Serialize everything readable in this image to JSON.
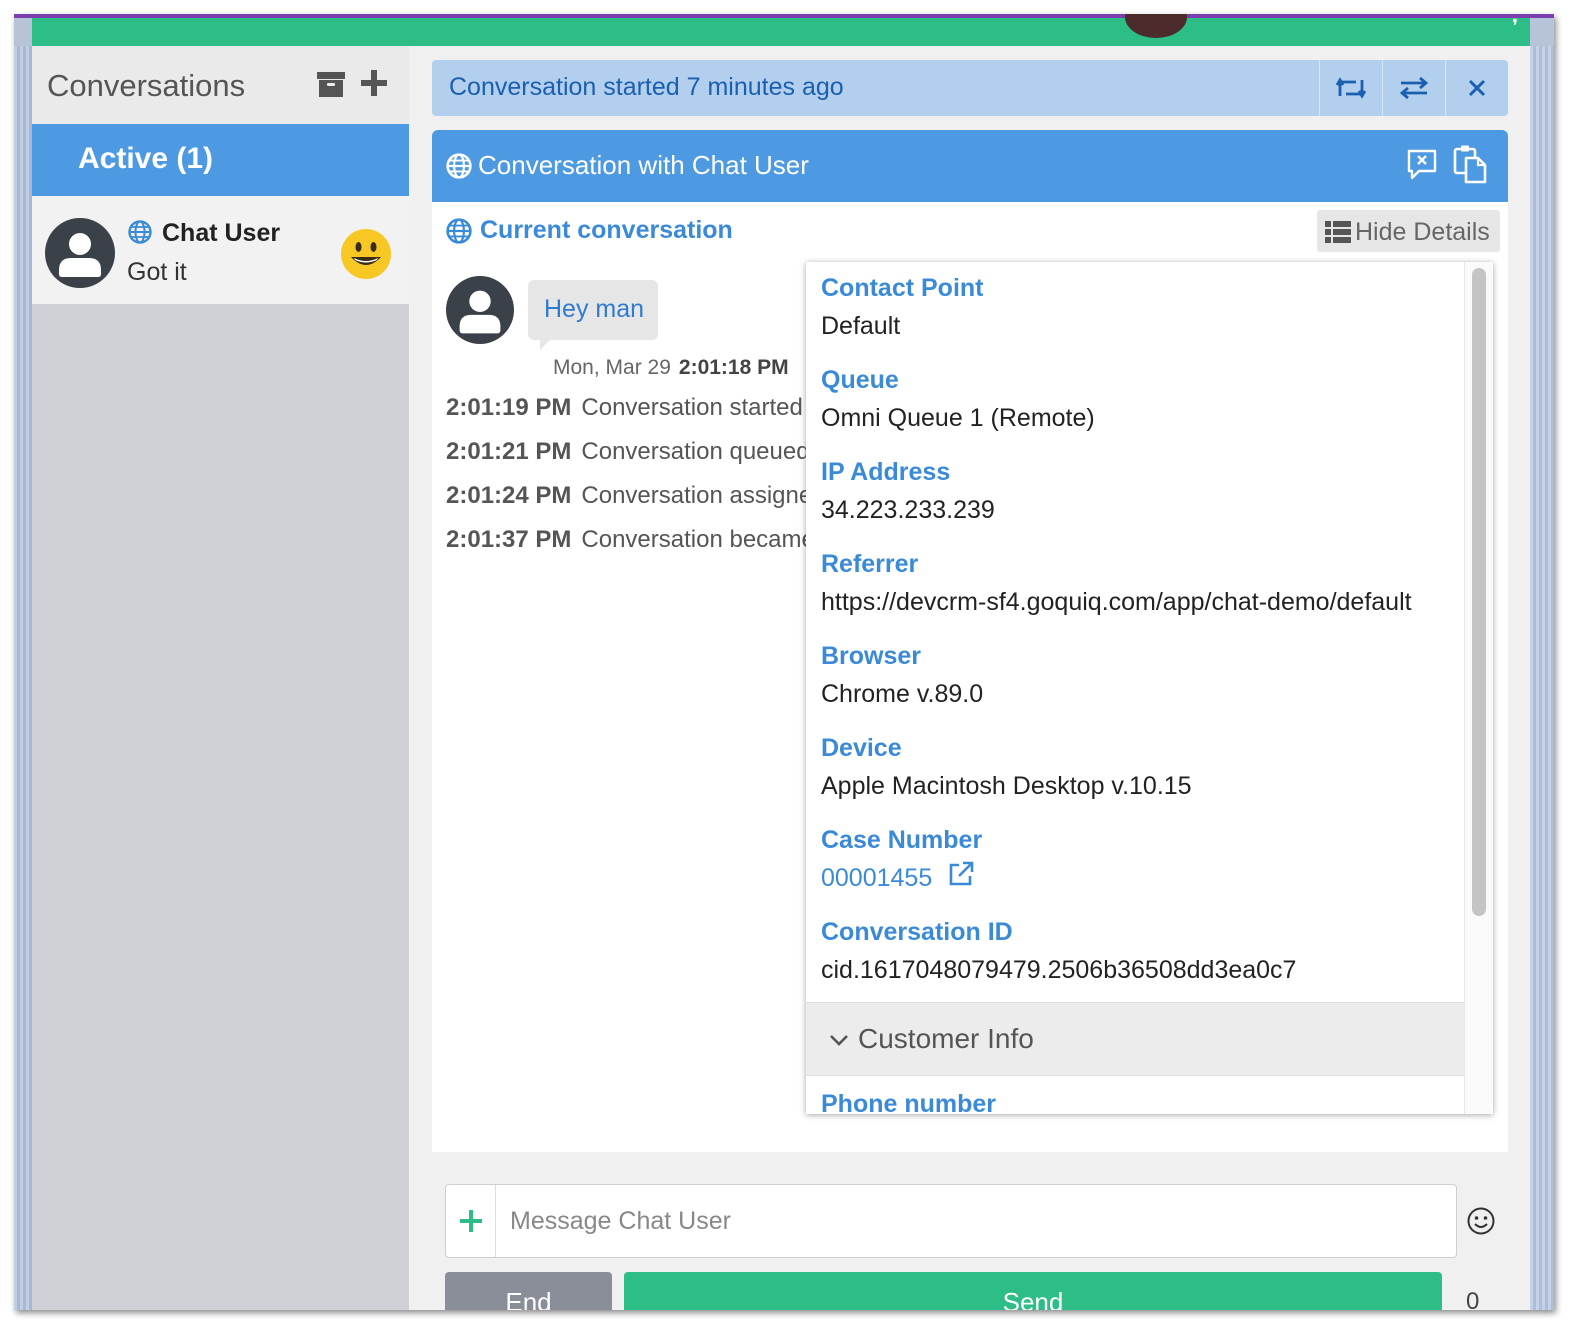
{
  "sidebar": {
    "title": "Conversations",
    "active_tab": "Active (1)",
    "conversation": {
      "name": "Chat User",
      "preview": "Got it"
    }
  },
  "header": {
    "status_text": "Conversation started 7 minutes ago",
    "panel_title": "Conversation with Chat User"
  },
  "conversation": {
    "section_label": "Current conversation",
    "hide_details_label": "Hide Details",
    "message": {
      "text": "Hey man",
      "date": "Mon, Mar 29",
      "time": "2:01:18 PM"
    },
    "events": [
      {
        "time": "2:01:19 PM",
        "text": "Conversation started"
      },
      {
        "time": "2:01:21 PM",
        "text": "Conversation queued"
      },
      {
        "time": "2:01:24 PM",
        "text": "Conversation assigned"
      },
      {
        "time": "2:01:37 PM",
        "text": "Conversation became"
      }
    ]
  },
  "details": {
    "fields": [
      {
        "label": "Contact Point",
        "value": "Default"
      },
      {
        "label": "Queue",
        "value": "Omni Queue 1 (Remote)"
      },
      {
        "label": "IP Address",
        "value": "34.223.233.239"
      },
      {
        "label": "Referrer",
        "value": "https://devcrm-sf4.goquiq.com/app/chat-demo/default"
      },
      {
        "label": "Browser",
        "value": "Chrome v.89.0"
      },
      {
        "label": "Device",
        "value": "Apple Macintosh Desktop v.10.15"
      },
      {
        "label": "Case Number",
        "value": "00001455"
      },
      {
        "label": "Conversation ID",
        "value": "cid.1617048079479.2506b36508dd3ea0c7"
      }
    ],
    "customer_info_label": "Customer Info",
    "phone_label": "Phone number"
  },
  "composer": {
    "placeholder": "Message Chat User",
    "end_label": "End",
    "send_label": "Send",
    "char_count": "0"
  },
  "colors": {
    "accent_blue": "#4d99e2",
    "brand_green": "#2dbd87",
    "link_blue": "#3b8ad8"
  },
  "icons": [
    "archive-icon",
    "plus-icon",
    "globe-icon",
    "smiley-emoji-icon",
    "retweet-icon",
    "transfer-icon",
    "close-icon",
    "end-chat-icon",
    "copy-icon",
    "list-icon",
    "external-link-icon",
    "chevron-down-icon",
    "emoji-icon",
    "user-avatar-icon"
  ]
}
